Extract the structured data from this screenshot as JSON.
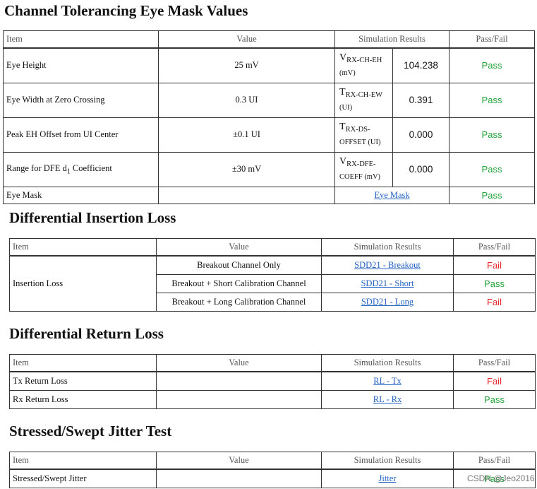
{
  "s1": {
    "title": "Channel Tolerancing Eye Mask Values",
    "headers": {
      "item": "Item",
      "value": "Value",
      "sim": "Simulation Results",
      "pf": "Pass/Fail"
    },
    "rows": [
      {
        "item": "Eye Height",
        "value": "25 mV",
        "sym_main": "V",
        "sym_sub": "RX-CH-EH",
        "sym_extra": "",
        "sym_unit": "(mV)",
        "result": "104.238",
        "pf": "Pass"
      },
      {
        "item": "Eye Width at Zero Crossing",
        "value": "0.3 UI",
        "sym_main": "T",
        "sym_sub": "RX-CH-EW",
        "sym_extra": "",
        "sym_unit": "(UI)",
        "result": "0.391",
        "pf": "Pass"
      },
      {
        "item": "Peak EH Offset from UI Center",
        "value": "±0.1 UI",
        "sym_main": "T",
        "sym_sub": "RX-DS-",
        "sym_extra": "OFFSET",
        "sym_unit": " (UI)",
        "result": "0.000",
        "pf": "Pass"
      },
      {
        "item_pre": "Range for DFE d",
        "item_sub": "1",
        "item_post": " Coefficient",
        "value": "±30 mV",
        "sym_main": "V",
        "sym_sub": "RX-DFE-",
        "sym_extra": "COEFF",
        "sym_unit": " (mV)",
        "result": "0.000",
        "pf": "Pass"
      }
    ],
    "eye_mask": {
      "item": "Eye Mask",
      "link": "Eye Mask",
      "pf": "Pass"
    }
  },
  "s2": {
    "title": "Differential Insertion Loss",
    "headers": {
      "item": "Item",
      "value": "Value",
      "sim": "Simulation Results",
      "pf": "Pass/Fail"
    },
    "item": "Insertion Loss",
    "rows": [
      {
        "value": "Breakout Channel Only",
        "link": "SDD21 - Breakout",
        "pf": "Fail"
      },
      {
        "value": "Breakout + Short Calibration Channel",
        "link": "SDD21 - Short",
        "pf": "Pass"
      },
      {
        "value": "Breakout + Long Calibration Channel",
        "link": "SDD21 - Long",
        "pf": "Fail"
      }
    ]
  },
  "s3": {
    "title": "Differential Return Loss",
    "headers": {
      "item": "Item",
      "value": "Value",
      "sim": "Simulation Results",
      "pf": "Pass/Fail"
    },
    "rows": [
      {
        "item": "Tx Return Loss",
        "link": "RL - Tx",
        "pf": "Fail"
      },
      {
        "item": "Rx Return Loss",
        "link": "RL - Rx",
        "pf": "Pass"
      }
    ]
  },
  "s4": {
    "title": "Stressed/Swept Jitter Test",
    "headers": {
      "item": "Item",
      "value": "Value",
      "sim": "Simulation Results",
      "pf": "Pass/Fail"
    },
    "rows": [
      {
        "item": "Stressed/Swept Jitter",
        "link": "Jitter",
        "pf": "Pass"
      }
    ]
  },
  "watermark": "CSDN @Jeo2016",
  "colors": {
    "pass": "#22a33a",
    "fail": "#e8262a",
    "link": "#2563c4"
  }
}
